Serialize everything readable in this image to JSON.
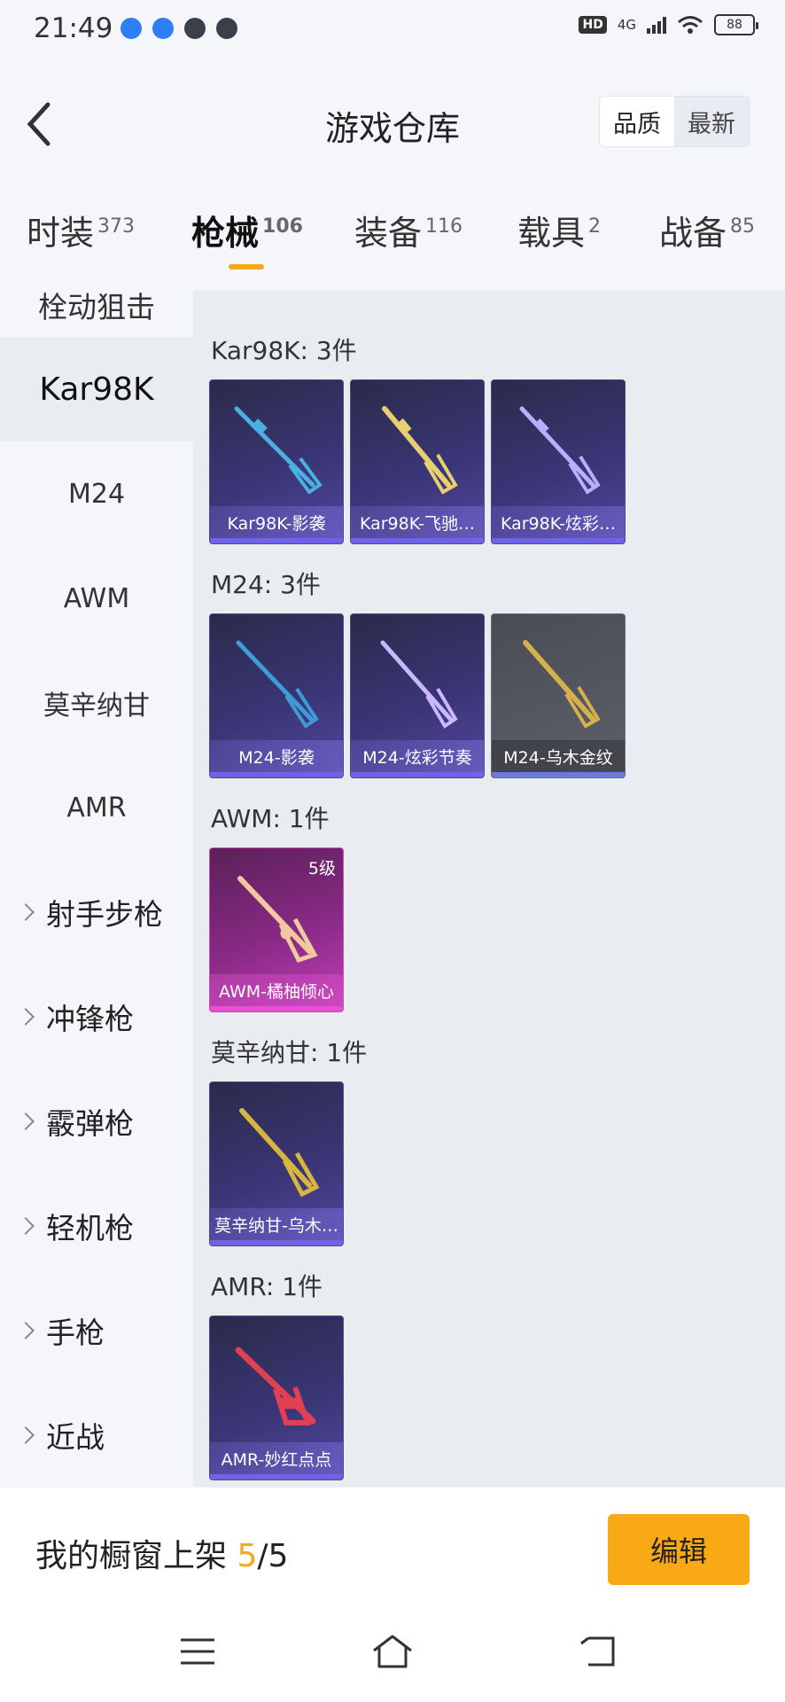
{
  "status_bar": {
    "time": "21:49",
    "hd": "HD",
    "network": "4G",
    "battery": "88"
  },
  "header": {
    "title": "游戏仓库",
    "sort_options": [
      "品质",
      "最新"
    ],
    "active_sort": "品质"
  },
  "tabs": [
    {
      "label": "时装",
      "count": "373"
    },
    {
      "label": "枪械",
      "count": "106"
    },
    {
      "label": "装备",
      "count": "116"
    },
    {
      "label": "载具",
      "count": "2"
    },
    {
      "label": "战备",
      "count": "85"
    }
  ],
  "active_tab": "枪械",
  "sidebar": {
    "cut_off_item": "栓动狙击",
    "items": [
      "Kar98K",
      "M24",
      "AWM",
      "莫辛纳甘",
      "AMR"
    ],
    "active_item": "Kar98K",
    "groups": [
      "射手步枪",
      "冲锋枪",
      "霰弹枪",
      "轻机枪",
      "手枪",
      "近战"
    ]
  },
  "sections": [
    {
      "title": "Kar98K: 3件",
      "items": [
        {
          "name": "Kar98K-影袭",
          "gun_color": "#4ab0e0"
        },
        {
          "name": "Kar98K-飞驰…",
          "gun_color": "#e8d070"
        },
        {
          "name": "Kar98K-炫彩…",
          "gun_color": "#b8b0ff"
        }
      ]
    },
    {
      "title": "M24: 3件",
      "items": [
        {
          "name": "M24-影袭",
          "gun_color": "#3f9ad8"
        },
        {
          "name": "M24-炫彩节奏",
          "gun_color": "#c9b8ff"
        },
        {
          "name": "M24-乌木金纹",
          "gun_color": "#d6b04a",
          "style": "grey"
        }
      ]
    },
    {
      "title": "AWM: 1件",
      "items": [
        {
          "name": "AWM-橘柚倾心",
          "gun_color": "#f2c8a0",
          "style": "pink",
          "level": "5级"
        }
      ]
    },
    {
      "title": "莫辛纳甘: 1件",
      "items": [
        {
          "name": "莫辛纳甘-乌木…",
          "gun_color": "#d8b440"
        }
      ]
    },
    {
      "title": "AMR: 1件",
      "items": [
        {
          "name": "AMR-妙红点点",
          "gun_color": "#e04050"
        }
      ]
    }
  ],
  "bottom_bar": {
    "showcase_label": "我的橱窗上架",
    "showcase_current": "5",
    "showcase_total": "/5",
    "edit_label": "编辑"
  },
  "nav_icons": [
    "menu-icon",
    "home-icon",
    "back-icon"
  ]
}
